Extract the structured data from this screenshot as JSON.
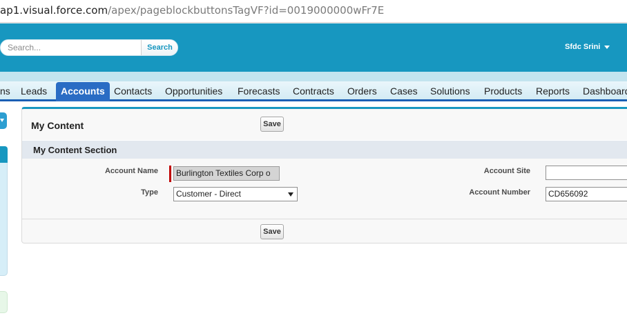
{
  "browser": {
    "url_host": "ap1.visual.force.com",
    "url_path": "/apex/pageblockbuttonsTagVF?id=0019000000wFr7E"
  },
  "header": {
    "search_placeholder": "Search...",
    "search_button": "Search",
    "user_name": "Sfdc Srini"
  },
  "tabs": [
    {
      "label": "ns",
      "active": false
    },
    {
      "label": "Leads",
      "active": false
    },
    {
      "label": "Accounts",
      "active": true
    },
    {
      "label": "Contacts",
      "active": false
    },
    {
      "label": "Opportunities",
      "active": false
    },
    {
      "label": "Forecasts",
      "active": false
    },
    {
      "label": "Contracts",
      "active": false
    },
    {
      "label": "Orders",
      "active": false
    },
    {
      "label": "Cases",
      "active": false
    },
    {
      "label": "Solutions",
      "active": false
    },
    {
      "label": "Products",
      "active": false
    },
    {
      "label": "Reports",
      "active": false
    },
    {
      "label": "Dashboards",
      "active": false
    }
  ],
  "page_block": {
    "title": "My Content",
    "save_button_top": "Save",
    "save_button_bottom": "Save",
    "section": {
      "title": "My Content Section",
      "fields": {
        "account_name_label": "Account Name",
        "account_name_value": "Burlington Textiles Corp o",
        "type_label": "Type",
        "type_value": "Customer - Direct",
        "account_site_label": "Account Site",
        "account_site_value": "",
        "account_number_label": "Account Number",
        "account_number_value": "CD656092"
      }
    }
  },
  "colors": {
    "header_blue": "#1797c0",
    "active_tab": "#2a6cc4",
    "tab_underline": "#1a5fb4",
    "required_marker": "#c00000"
  }
}
